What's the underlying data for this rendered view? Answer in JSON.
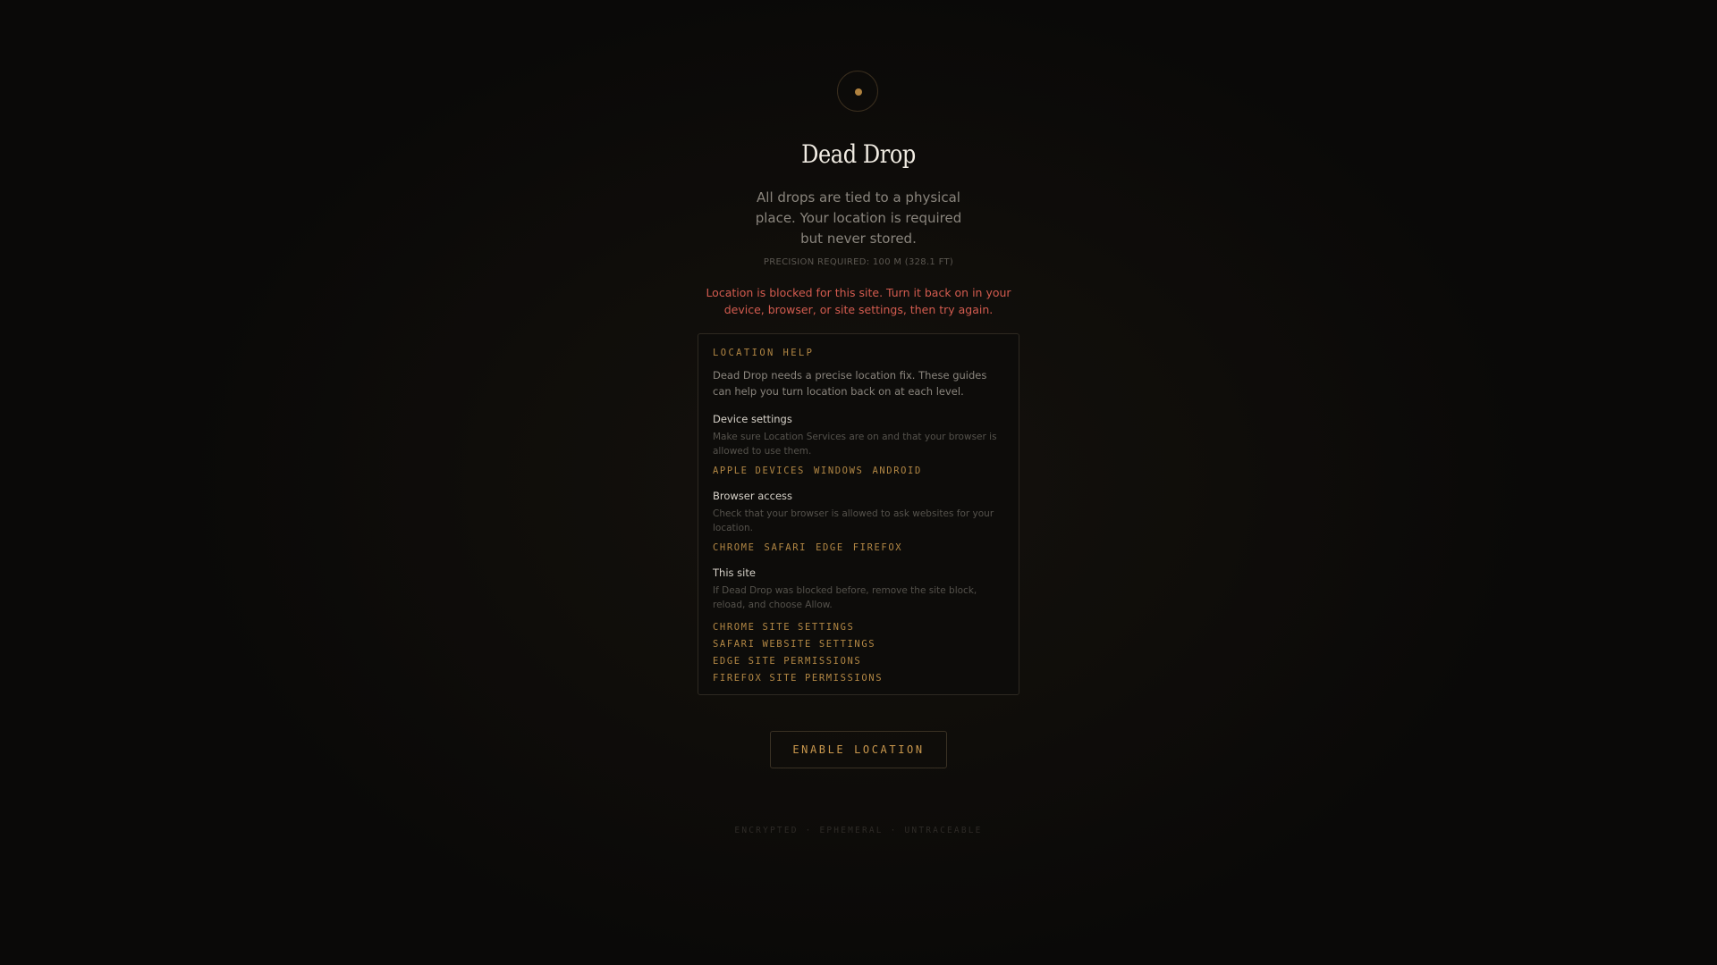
{
  "app": {
    "title": "Dead Drop",
    "subtitle": "All drops are tied to a physical place. Your location is required but never stored.",
    "precision": "PRECISION REQUIRED: 100 M (328.1 FT)",
    "error": "Location is blocked for this site. Turn it back on in your device, browser, or site settings, then try again."
  },
  "help": {
    "title": "LOCATION HELP",
    "intro": "Dead Drop needs a precise location fix. These guides can help you turn location back on at each level.",
    "sections": [
      {
        "title": "Device settings",
        "desc": "Make sure Location Services are on and that your browser is allowed to use them.",
        "links": [
          "APPLE DEVICES",
          "WINDOWS",
          "ANDROID"
        ]
      },
      {
        "title": "Browser access",
        "desc": "Check that your browser is allowed to ask websites for your location.",
        "links": [
          "CHROME",
          "SAFARI",
          "EDGE",
          "FIREFOX"
        ]
      },
      {
        "title": "This site",
        "desc": "If Dead Drop was blocked before, remove the site block, reload, and choose Allow.",
        "links": [
          "CHROME SITE SETTINGS",
          "SAFARI WEBSITE SETTINGS",
          "EDGE SITE PERMISSIONS",
          "FIREFOX SITE PERMISSIONS"
        ]
      }
    ]
  },
  "button": {
    "label": "ENABLE LOCATION"
  },
  "footer": {
    "text": "ENCRYPTED · EPHEMERAL · UNTRACEABLE"
  },
  "colors": {
    "background": "#0a0908",
    "accent": "#b28744",
    "error": "#d25b4f",
    "title": "#f1ece3"
  },
  "icons": {
    "logo": "location-dot-icon"
  }
}
